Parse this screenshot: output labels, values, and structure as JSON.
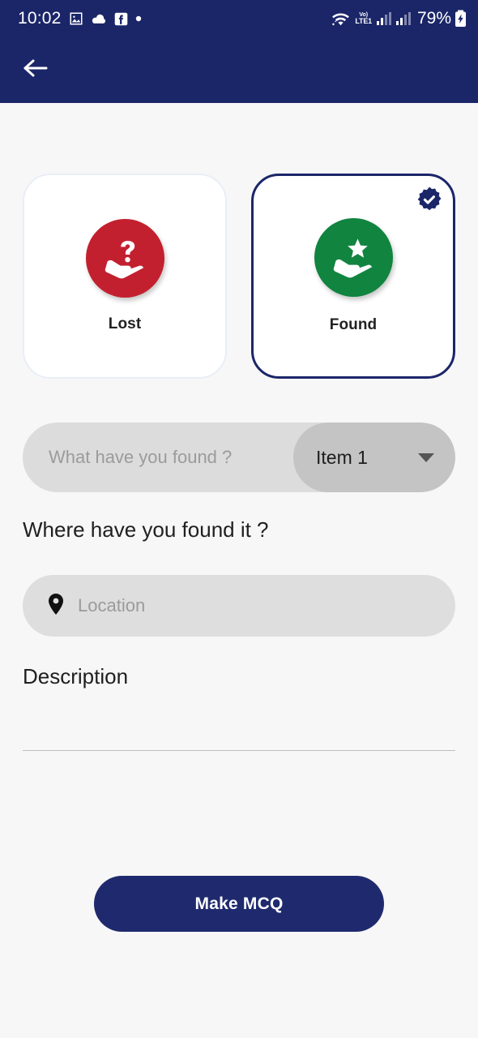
{
  "status_bar": {
    "clock": "10:02",
    "left_icons": [
      "image-icon",
      "cloud-icon",
      "facebook-icon",
      "dot-icon"
    ],
    "right_icons": [
      "wifi-icon",
      "volte-icon",
      "signal-bars-1-icon",
      "signal-bars-2-icon",
      "battery-charging-icon"
    ],
    "volte_top": "Vo)",
    "volte_bottom": "LTE1",
    "battery_percent": "79%",
    "background_color": "#1b2669"
  },
  "app_bar": {
    "back_icon": "arrow-left-icon",
    "background_color": "#1b2669"
  },
  "type_selector": {
    "options": [
      {
        "key": "lost",
        "label": "Lost",
        "icon": "hand-question-icon",
        "circle_color": "#c3202f",
        "selected": false
      },
      {
        "key": "found",
        "label": "Found",
        "icon": "hand-star-icon",
        "circle_color": "#118440",
        "selected": true,
        "badge_icon": "verified-check-badge-icon"
      }
    ],
    "selected_border_color": "#1b2669"
  },
  "item_row": {
    "input_value": "",
    "input_placeholder": "What have you found ?",
    "dropdown_value": "Item 1",
    "dropdown_caret_icon": "chevron-down-icon",
    "field_background": "#dcdcdc",
    "dropdown_background": "#c4c4c4"
  },
  "where_section": {
    "heading": "Where have you found it ?",
    "location_icon": "map-pin-icon",
    "location_value": "",
    "location_placeholder": "Location"
  },
  "description_section": {
    "heading": "Description",
    "value": "",
    "placeholder": ""
  },
  "footer": {
    "primary_button_label": "Make MCQ",
    "primary_button_color": "#1f2a6e"
  }
}
